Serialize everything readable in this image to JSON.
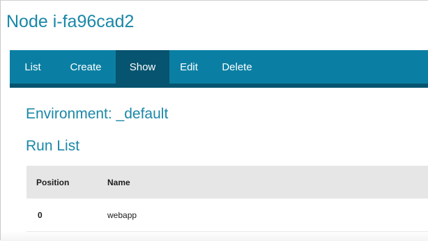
{
  "page": {
    "title": "Node i-fa96cad2"
  },
  "nav": {
    "items": [
      {
        "label": "List",
        "active": false
      },
      {
        "label": "Create",
        "active": false
      },
      {
        "label": "Show",
        "active": true
      },
      {
        "label": "Edit",
        "active": false
      },
      {
        "label": "Delete",
        "active": false
      }
    ]
  },
  "environment": {
    "label": "Environment: _default"
  },
  "run_list": {
    "title": "Run List",
    "columns": [
      "Position",
      "Name"
    ],
    "rows": [
      {
        "position": "0",
        "name": "webapp"
      }
    ]
  },
  "colors": {
    "accent": "#1a87a8",
    "nav_bg": "#0a7fa3",
    "nav_active": "#06546f",
    "table_header_bg": "#e6e6e6"
  }
}
